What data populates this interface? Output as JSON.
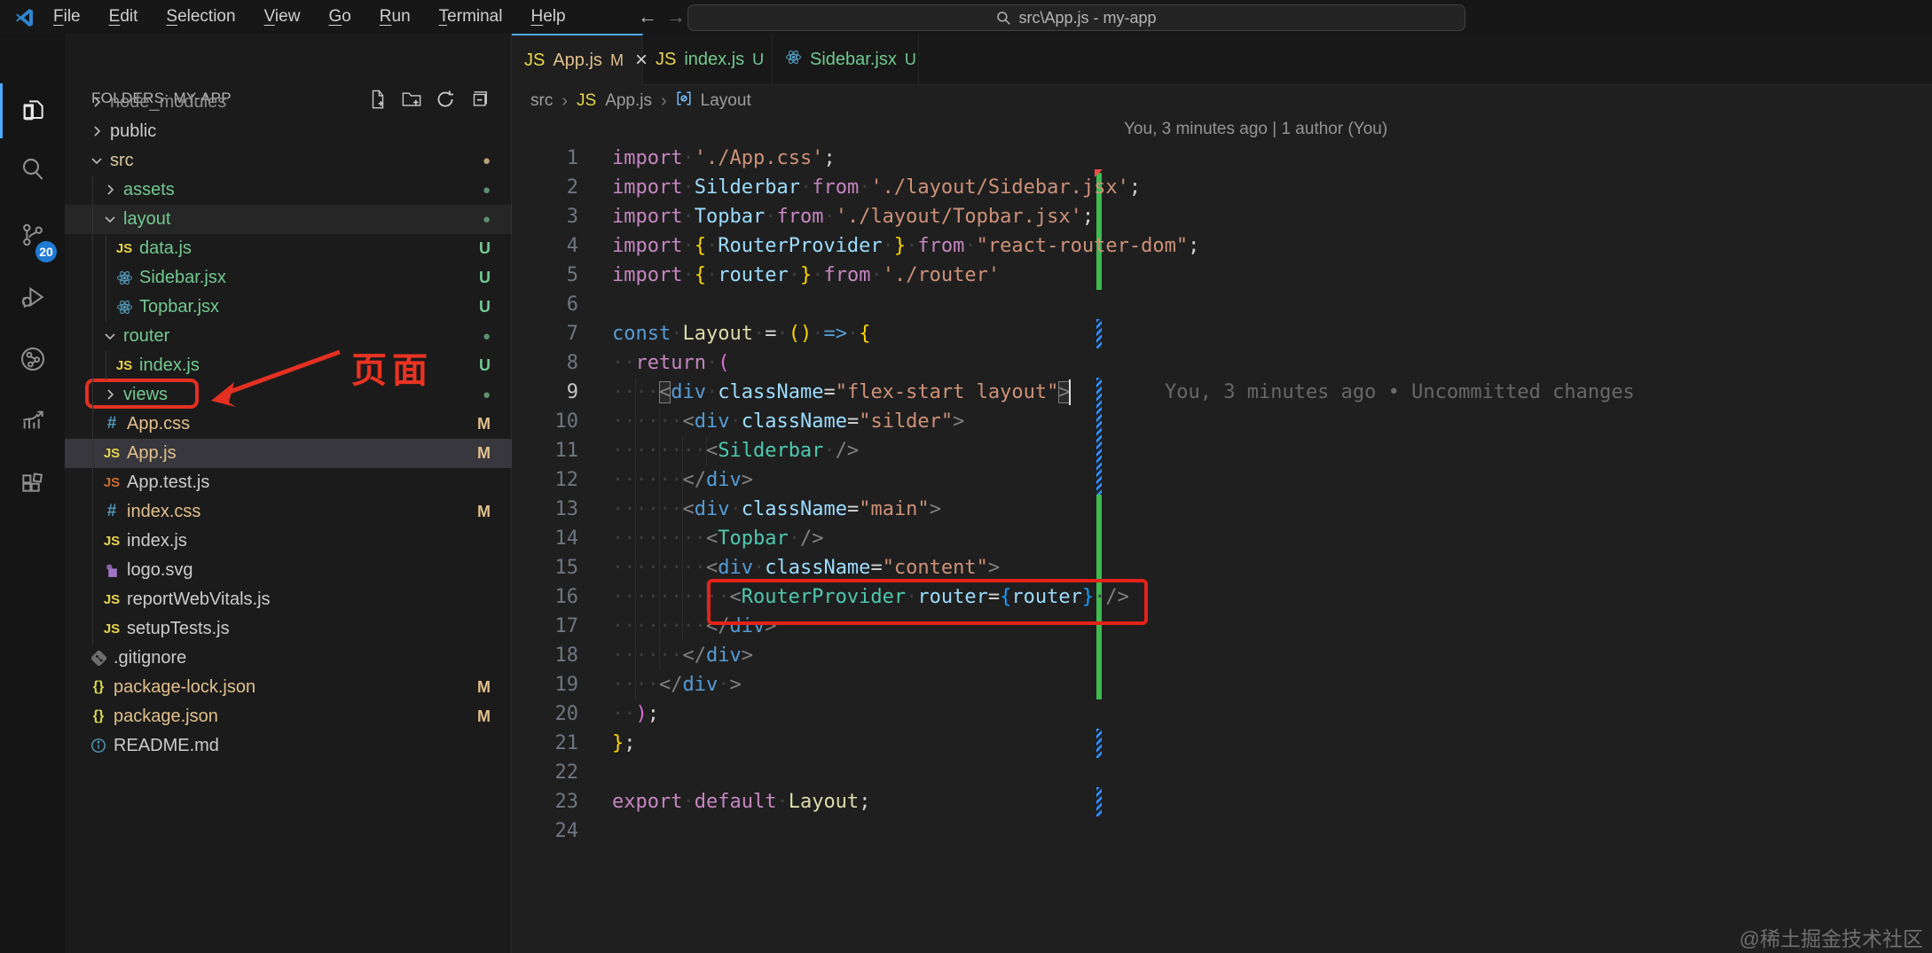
{
  "title_bar": {
    "menu": [
      "File",
      "Edit",
      "Selection",
      "View",
      "Go",
      "Run",
      "Terminal",
      "Help"
    ],
    "back_arrow": "←",
    "forward_arrow": "→",
    "search_text": "src\\App.js - my-app"
  },
  "activity_bar": {
    "icons": [
      "explorer",
      "search",
      "source-control",
      "run-debug",
      "live-share",
      "stats",
      "extensions"
    ],
    "scm_badge": "20"
  },
  "sidebar": {
    "header": "FOLDERS: MY-APP",
    "actions": [
      "new-file",
      "new-folder",
      "refresh",
      "collapse-all"
    ],
    "tree": [
      {
        "name": "node_modules",
        "level": 0,
        "kind": "folder",
        "expanded": false,
        "color": "#8c8c8c",
        "badge": null
      },
      {
        "name": "public",
        "level": 0,
        "kind": "folder",
        "expanded": false,
        "color": "#cccccc",
        "badge": null
      },
      {
        "name": "src",
        "level": 0,
        "kind": "folder",
        "expanded": true,
        "color": "#dcc99f",
        "badge": "dot",
        "badgeColor": "#b5a477"
      },
      {
        "name": "assets",
        "level": 1,
        "kind": "folder",
        "expanded": false,
        "color": "#73c991",
        "badge": "dot",
        "badgeColor": "#5d8f72"
      },
      {
        "name": "layout",
        "level": 1,
        "kind": "folder",
        "expanded": true,
        "color": "#73c991",
        "badge": "dot",
        "badgeColor": "#5d8f72",
        "highlight": true
      },
      {
        "name": "data.js",
        "level": 2,
        "kind": "file",
        "icon": "js",
        "color": "#73c991",
        "badge": "U",
        "badgeColor": "#73c991"
      },
      {
        "name": "Sidebar.jsx",
        "level": 2,
        "kind": "file",
        "icon": "react",
        "color": "#73c991",
        "badge": "U",
        "badgeColor": "#73c991"
      },
      {
        "name": "Topbar.jsx",
        "level": 2,
        "kind": "file",
        "icon": "react",
        "color": "#73c991",
        "badge": "U",
        "badgeColor": "#73c991"
      },
      {
        "name": "router",
        "level": 1,
        "kind": "folder",
        "expanded": true,
        "color": "#73c991",
        "badge": "dot",
        "badgeColor": "#5d8f72"
      },
      {
        "name": "index.js",
        "level": 2,
        "kind": "file",
        "icon": "js",
        "color": "#73c991",
        "badge": "U",
        "badgeColor": "#73c991"
      },
      {
        "name": "views",
        "level": 1,
        "kind": "folder",
        "expanded": false,
        "color": "#73c991",
        "badge": "dot",
        "badgeColor": "#5d8f72",
        "redbox": true
      },
      {
        "name": "App.css",
        "level": 1,
        "kind": "file",
        "icon": "css",
        "color": "#e2c08d",
        "badge": "M",
        "badgeColor": "#e2c08d"
      },
      {
        "name": "App.js",
        "level": 1,
        "kind": "file",
        "icon": "js",
        "color": "#e2c08d",
        "badge": "M",
        "badgeColor": "#e2c08d",
        "selected": true
      },
      {
        "name": "App.test.js",
        "level": 1,
        "kind": "file",
        "icon": "js-orange",
        "color": "#cccccc",
        "badge": null
      },
      {
        "name": "index.css",
        "level": 1,
        "kind": "file",
        "icon": "css",
        "color": "#e2c08d",
        "badge": "M",
        "badgeColor": "#e2c08d"
      },
      {
        "name": "index.js",
        "level": 1,
        "kind": "file",
        "icon": "js",
        "color": "#cccccc",
        "badge": null
      },
      {
        "name": "logo.svg",
        "level": 1,
        "kind": "file",
        "icon": "svg",
        "color": "#cccccc",
        "badge": null
      },
      {
        "name": "reportWebVitals.js",
        "level": 1,
        "kind": "file",
        "icon": "js",
        "color": "#cccccc",
        "badge": null
      },
      {
        "name": "setupTests.js",
        "level": 1,
        "kind": "file",
        "icon": "js",
        "color": "#cccccc",
        "badge": null
      },
      {
        "name": ".gitignore",
        "level": 0,
        "kind": "file",
        "icon": "git",
        "color": "#cccccc",
        "badge": null
      },
      {
        "name": "package-lock.json",
        "level": 0,
        "kind": "file",
        "icon": "json",
        "color": "#e2c08d",
        "badge": "M",
        "badgeColor": "#e2c08d"
      },
      {
        "name": "package.json",
        "level": 0,
        "kind": "file",
        "icon": "json",
        "color": "#e2c08d",
        "badge": "M",
        "badgeColor": "#e2c08d"
      },
      {
        "name": "README.md",
        "level": 0,
        "kind": "file",
        "icon": "info",
        "color": "#cccccc",
        "badge": null
      }
    ]
  },
  "tabs": [
    {
      "label": "App.js",
      "icon": "js",
      "color": "#e2c08d",
      "badge": "M",
      "badgeColor": "#e2c08d",
      "close": "×",
      "active": true
    },
    {
      "label": "index.js",
      "icon": "js",
      "color": "#73c991",
      "badge": "U",
      "badgeColor": "#73c991",
      "active": false
    },
    {
      "label": "Sidebar.jsx",
      "icon": "react",
      "color": "#73c991",
      "badge": "U",
      "badgeColor": "#73c991",
      "active": false
    }
  ],
  "breadcrumb": [
    {
      "label": "src",
      "icon": null
    },
    {
      "label": "App.js",
      "icon": "js"
    },
    {
      "label": "Layout",
      "icon": "symbol"
    }
  ],
  "editor": {
    "codelens": "You, 3 minutes ago | 1 author (You)",
    "inline_blame": "You, 3 minutes ago • Uncommitted changes",
    "lines": [
      {
        "n": 1,
        "tokens": [
          [
            "kw",
            "import"
          ],
          [
            "ws",
            1
          ],
          [
            "str",
            "'./App.css'"
          ],
          [
            "pun",
            ";"
          ]
        ]
      },
      {
        "n": 2,
        "tokens": [
          [
            "kw",
            "import"
          ],
          [
            "ws",
            1
          ],
          [
            "var",
            "Silderbar"
          ],
          [
            "ws",
            1
          ],
          [
            "kw",
            "from"
          ],
          [
            "ws",
            1
          ],
          [
            "str",
            "'./layout/Sidebar.jsx'"
          ],
          [
            "pun",
            ";"
          ]
        ]
      },
      {
        "n": 3,
        "tokens": [
          [
            "kw",
            "import"
          ],
          [
            "ws",
            1
          ],
          [
            "var",
            "Topbar"
          ],
          [
            "ws",
            1
          ],
          [
            "kw",
            "from"
          ],
          [
            "ws",
            1
          ],
          [
            "str",
            "'./layout/Topbar.jsx'"
          ],
          [
            "pun",
            ";"
          ]
        ]
      },
      {
        "n": 4,
        "tokens": [
          [
            "kw",
            "import"
          ],
          [
            "ws",
            1
          ],
          [
            "brY",
            "{"
          ],
          [
            "ws",
            1
          ],
          [
            "var",
            "RouterProvider"
          ],
          [
            "ws",
            1
          ],
          [
            "brY",
            "}"
          ],
          [
            "ws",
            1
          ],
          [
            "kw",
            "from"
          ],
          [
            "ws",
            1
          ],
          [
            "str",
            "\"react-router-dom\""
          ],
          [
            "pun",
            ";"
          ]
        ]
      },
      {
        "n": 5,
        "tokens": [
          [
            "kw",
            "import"
          ],
          [
            "ws",
            1
          ],
          [
            "brY",
            "{"
          ],
          [
            "ws",
            1
          ],
          [
            "var",
            "router"
          ],
          [
            "ws",
            1
          ],
          [
            "brY",
            "}"
          ],
          [
            "ws",
            1
          ],
          [
            "kw",
            "from"
          ],
          [
            "ws",
            1
          ],
          [
            "str",
            "'./router'"
          ]
        ]
      },
      {
        "n": 6,
        "tokens": []
      },
      {
        "n": 7,
        "tokens": [
          [
            "kw2",
            "const"
          ],
          [
            "ws",
            1
          ],
          [
            "fn",
            "Layout"
          ],
          [
            "ws",
            1
          ],
          [
            "pun",
            "="
          ],
          [
            "ws",
            1
          ],
          [
            "brY",
            "()"
          ],
          [
            "ws",
            1
          ],
          [
            "kw2",
            "=>"
          ],
          [
            "ws",
            1
          ],
          [
            "brY",
            "{"
          ]
        ]
      },
      {
        "n": 8,
        "tokens": [
          [
            "ws",
            2
          ],
          [
            "kw",
            "return"
          ],
          [
            "ws",
            1
          ],
          [
            "brP",
            "("
          ]
        ]
      },
      {
        "n": 9,
        "tokens": [
          [
            "ws",
            4
          ],
          [
            "tagp",
            "<",
            "box"
          ],
          [
            "tag",
            "div"
          ],
          [
            "ws",
            1
          ],
          [
            "attr",
            "className"
          ],
          [
            "pun",
            "="
          ],
          [
            "str",
            "\"flex-start layout\""
          ],
          [
            "tagp",
            ">",
            "box"
          ]
        ]
      },
      {
        "n": 10,
        "tokens": [
          [
            "ws",
            6
          ],
          [
            "tagp",
            "<"
          ],
          [
            "tag",
            "div"
          ],
          [
            "ws",
            1
          ],
          [
            "attr",
            "className"
          ],
          [
            "pun",
            "="
          ],
          [
            "str",
            "\"silder\""
          ],
          [
            "tagp",
            ">"
          ]
        ]
      },
      {
        "n": 11,
        "tokens": [
          [
            "ws",
            8
          ],
          [
            "tagp",
            "<"
          ],
          [
            "comp",
            "Silderbar"
          ],
          [
            "ws",
            1
          ],
          [
            "tagp",
            "/>"
          ]
        ]
      },
      {
        "n": 12,
        "tokens": [
          [
            "ws",
            6
          ],
          [
            "tagp",
            "</"
          ],
          [
            "tag",
            "div"
          ],
          [
            "tagp",
            ">"
          ]
        ]
      },
      {
        "n": 13,
        "tokens": [
          [
            "ws",
            6
          ],
          [
            "tagp",
            "<"
          ],
          [
            "tag",
            "div"
          ],
          [
            "ws",
            1
          ],
          [
            "attr",
            "className"
          ],
          [
            "pun",
            "="
          ],
          [
            "str",
            "\"main\""
          ],
          [
            "tagp",
            ">"
          ]
        ]
      },
      {
        "n": 14,
        "tokens": [
          [
            "ws",
            8
          ],
          [
            "tagp",
            "<"
          ],
          [
            "comp",
            "Topbar"
          ],
          [
            "ws",
            1
          ],
          [
            "tagp",
            "/>"
          ]
        ]
      },
      {
        "n": 15,
        "tokens": [
          [
            "ws",
            8
          ],
          [
            "tagp",
            "<"
          ],
          [
            "tag",
            "div"
          ],
          [
            "ws",
            1
          ],
          [
            "attr",
            "className"
          ],
          [
            "pun",
            "="
          ],
          [
            "str",
            "\"content\""
          ],
          [
            "tagp",
            ">"
          ]
        ]
      },
      {
        "n": 16,
        "tokens": [
          [
            "ws",
            10
          ],
          [
            "tagp",
            "<"
          ],
          [
            "comp",
            "RouterProvider"
          ],
          [
            "ws",
            1
          ],
          [
            "attr",
            "router"
          ],
          [
            "pun",
            "="
          ],
          [
            "brB",
            "{"
          ],
          [
            "attr",
            "router"
          ],
          [
            "brB",
            "}"
          ],
          [
            "ws",
            1
          ],
          [
            "tagp",
            "/>"
          ]
        ],
        "redbox": true
      },
      {
        "n": 17,
        "tokens": [
          [
            "ws",
            8
          ],
          [
            "tagp",
            "</"
          ],
          [
            "tag",
            "div"
          ],
          [
            "tagp",
            ">"
          ]
        ]
      },
      {
        "n": 18,
        "tokens": [
          [
            "ws",
            6
          ],
          [
            "tagp",
            "</"
          ],
          [
            "tag",
            "div"
          ],
          [
            "tagp",
            ">"
          ]
        ]
      },
      {
        "n": 19,
        "tokens": [
          [
            "ws",
            4
          ],
          [
            "tagp",
            "</"
          ],
          [
            "tag",
            "div"
          ],
          [
            "ws",
            1
          ],
          [
            "tagp",
            ">"
          ]
        ]
      },
      {
        "n": 20,
        "tokens": [
          [
            "ws",
            2
          ],
          [
            "brP",
            ")"
          ],
          [
            "pun",
            ";"
          ]
        ]
      },
      {
        "n": 21,
        "tokens": [
          [
            "brY",
            "}"
          ],
          [
            "pun",
            ";"
          ]
        ]
      },
      {
        "n": 22,
        "tokens": []
      },
      {
        "n": 23,
        "tokens": [
          [
            "kw",
            "export"
          ],
          [
            "ws",
            1
          ],
          [
            "kw",
            "default"
          ],
          [
            "ws",
            1
          ],
          [
            "fn",
            "Layout"
          ],
          [
            "pun",
            ";"
          ]
        ]
      },
      {
        "n": 24,
        "tokens": []
      }
    ],
    "current_line": 9
  },
  "annotations": {
    "views_label": "页面"
  },
  "watermark": "@稀土掘金技术社区",
  "colors": {
    "accent": "#4daafc",
    "added": "#3fb950",
    "modified_stripe": "#3794ff",
    "annotation_red": "#e33022"
  }
}
